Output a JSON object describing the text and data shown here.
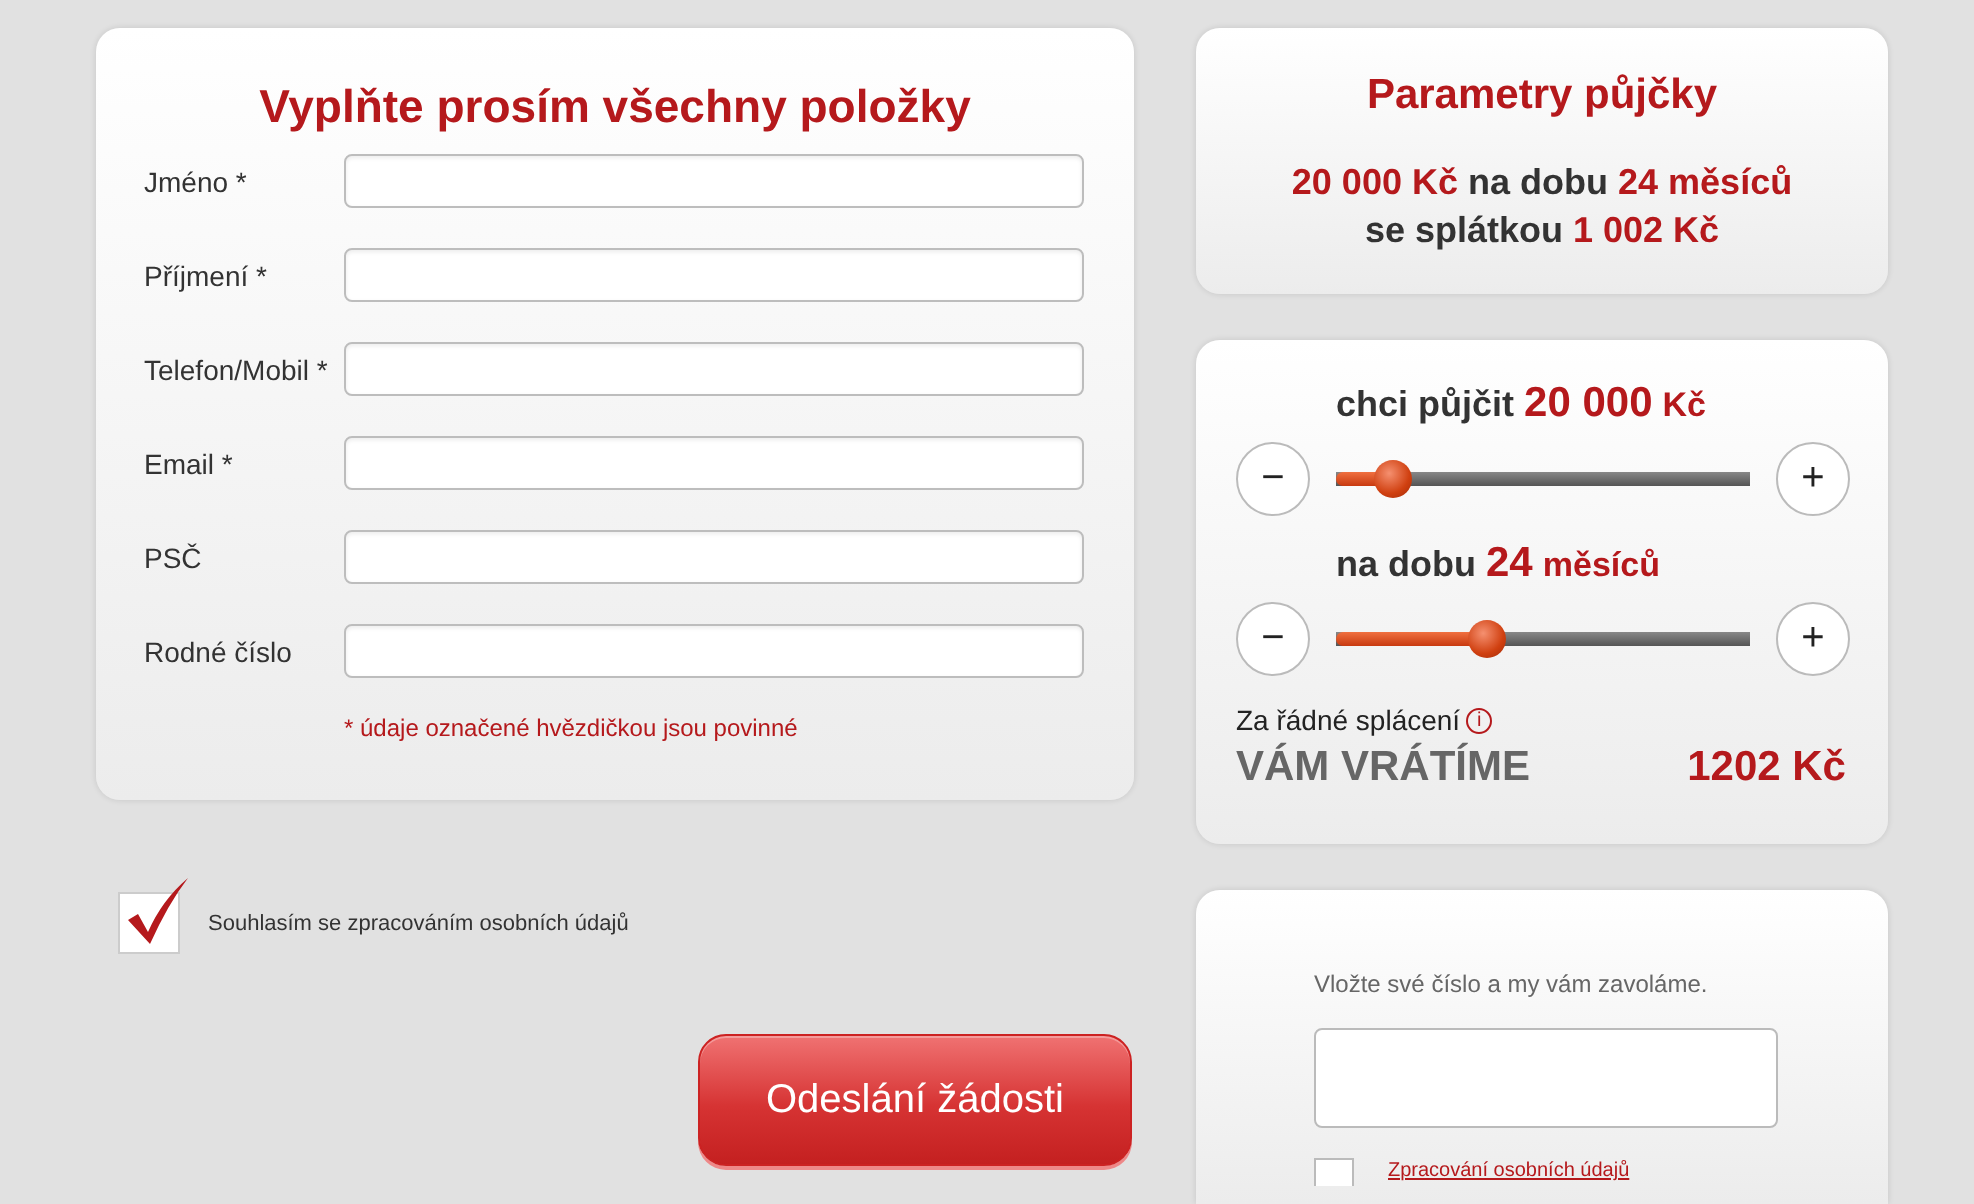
{
  "form": {
    "title": "Vyplňte prosím všechny položky",
    "fields": [
      {
        "label": "Jméno *"
      },
      {
        "label": "Příjmení *"
      },
      {
        "label": "Telefon/Mobil *"
      },
      {
        "label": "Email *"
      },
      {
        "label": "PSČ"
      },
      {
        "label": "Rodné číslo"
      }
    ],
    "note": "* údaje označené hvězdičkou jsou povinné"
  },
  "consent": {
    "label": "Souhlasím se zpracováním osobních údajů",
    "checked": true
  },
  "submit": "Odeslání žádosti",
  "parameters": {
    "title": "Parametry půjčky",
    "lines": [
      [
        {
          "text": "20 000 Kč",
          "highlight": true
        },
        {
          "text": "na dobu",
          "highlight": false
        },
        {
          "text": "24 měsíců",
          "highlight": true
        }
      ],
      [
        {
          "text": "se splátkou",
          "highlight": false
        },
        {
          "text": "1 002 Kč",
          "highlight": true
        }
      ]
    ]
  },
  "calculator": {
    "sliders": [
      {
        "label": "chci půjčit",
        "value": "20 000",
        "unit": "Kč",
        "level": 0.1,
        "minus": "−",
        "plus": "+"
      },
      {
        "label": "na dobu",
        "value": "24",
        "unit": "měsíců",
        "level": 0.35,
        "minus": "−",
        "plus": "+"
      }
    ],
    "refund_caption": "Za řádné splácení",
    "info": "i",
    "refund_label": "VÁM VRÁTÍME",
    "refund_value": "1202 Kč"
  },
  "callback": {
    "prompt": "Vložte své číslo a my vám zavoláme.",
    "consent": {
      "label": "Zpracování osobních údajů",
      "checked": false
    }
  }
}
